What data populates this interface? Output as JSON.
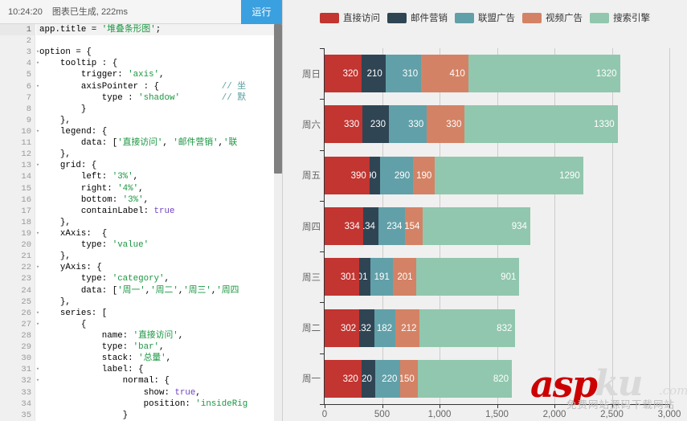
{
  "editor": {
    "status_time": "10:24:20",
    "status_message": "图表已生成, 222ms",
    "run_button_label": "运行",
    "active_line": 1,
    "scrollbar": {
      "name": "vertical-scrollbar"
    },
    "lines": [
      {
        "n": 1,
        "fold": "",
        "text": "app.title = '堆叠条形图';"
      },
      {
        "n": 2,
        "fold": "",
        "text": ""
      },
      {
        "n": 3,
        "fold": "▾",
        "text": "option = {"
      },
      {
        "n": 4,
        "fold": "▾",
        "text": "    tooltip : {"
      },
      {
        "n": 5,
        "fold": "",
        "text": "        trigger: 'axis',"
      },
      {
        "n": 6,
        "fold": "▾",
        "text": "        axisPointer : {            // 坐"
      },
      {
        "n": 7,
        "fold": "",
        "text": "            type : 'shadow'        // 默"
      },
      {
        "n": 8,
        "fold": "",
        "text": "        }"
      },
      {
        "n": 9,
        "fold": "",
        "text": "    },"
      },
      {
        "n": 10,
        "fold": "▾",
        "text": "    legend: {"
      },
      {
        "n": 11,
        "fold": "",
        "text": "        data: ['直接访问', '邮件营销','联"
      },
      {
        "n": 12,
        "fold": "",
        "text": "    },"
      },
      {
        "n": 13,
        "fold": "▾",
        "text": "    grid: {"
      },
      {
        "n": 14,
        "fold": "",
        "text": "        left: '3%',"
      },
      {
        "n": 15,
        "fold": "",
        "text": "        right: '4%',"
      },
      {
        "n": 16,
        "fold": "",
        "text": "        bottom: '3%',"
      },
      {
        "n": 17,
        "fold": "",
        "text": "        containLabel: true"
      },
      {
        "n": 18,
        "fold": "",
        "text": "    },"
      },
      {
        "n": 19,
        "fold": "▾",
        "text": "    xAxis:  {"
      },
      {
        "n": 20,
        "fold": "",
        "text": "        type: 'value'"
      },
      {
        "n": 21,
        "fold": "",
        "text": "    },"
      },
      {
        "n": 22,
        "fold": "▾",
        "text": "    yAxis: {"
      },
      {
        "n": 23,
        "fold": "",
        "text": "        type: 'category',"
      },
      {
        "n": 24,
        "fold": "",
        "text": "        data: ['周一','周二','周三','周四"
      },
      {
        "n": 25,
        "fold": "",
        "text": "    },"
      },
      {
        "n": 26,
        "fold": "▾",
        "text": "    series: ["
      },
      {
        "n": 27,
        "fold": "▾",
        "text": "        {"
      },
      {
        "n": 28,
        "fold": "",
        "text": "            name: '直接访问',"
      },
      {
        "n": 29,
        "fold": "",
        "text": "            type: 'bar',"
      },
      {
        "n": 30,
        "fold": "",
        "text": "            stack: '总量',"
      },
      {
        "n": 31,
        "fold": "▾",
        "text": "            label: {"
      },
      {
        "n": 32,
        "fold": "▾",
        "text": "                normal: {"
      },
      {
        "n": 33,
        "fold": "",
        "text": "                    show: true,"
      },
      {
        "n": 34,
        "fold": "",
        "text": "                    position: 'insideRig"
      },
      {
        "n": 35,
        "fold": "",
        "text": "                }"
      }
    ]
  },
  "chart_data": {
    "type": "bar",
    "orientation": "horizontal",
    "stacked": true,
    "title": "堆叠条形图",
    "xlabel": "",
    "ylabel": "",
    "xlim": [
      0,
      3000
    ],
    "xticks": [
      0,
      500,
      1000,
      1500,
      2000,
      2500,
      3000
    ],
    "xtick_labels": [
      "0",
      "500",
      "1,000",
      "1,500",
      "2,000",
      "2,500",
      "3,000"
    ],
    "grid": true,
    "legend_position": "top",
    "categories": [
      "周一",
      "周二",
      "周三",
      "周四",
      "周五",
      "周六",
      "周日"
    ],
    "display_order": [
      "周日",
      "周六",
      "周五",
      "周四",
      "周三",
      "周二",
      "周一"
    ],
    "series": [
      {
        "name": "直接访问",
        "color": "#c23531",
        "values": [
          320,
          302,
          301,
          334,
          390,
          330,
          320
        ]
      },
      {
        "name": "邮件营销",
        "color": "#2f4554",
        "values": [
          120,
          132,
          101,
          134,
          90,
          230,
          210
        ]
      },
      {
        "name": "联盟广告",
        "color": "#61a0a8",
        "values": [
          220,
          182,
          191,
          234,
          290,
          330,
          310
        ]
      },
      {
        "name": "视频广告",
        "color": "#d48265",
        "values": [
          150,
          212,
          201,
          154,
          190,
          330,
          410
        ]
      },
      {
        "name": "搜索引擎",
        "color": "#91c7ae",
        "values": [
          820,
          832,
          901,
          934,
          1290,
          1330,
          1320
        ]
      }
    ]
  },
  "watermark": {
    "brand_red": "asp",
    "brand_gray": "ku",
    "domain": "com",
    "subtitle": "免费网站源码下载网站"
  },
  "colors": {
    "accent_blue": "#3aa0e0",
    "chart_bg": "#f0f0f0",
    "axis": "#333333",
    "gridline": "#cccccc"
  }
}
